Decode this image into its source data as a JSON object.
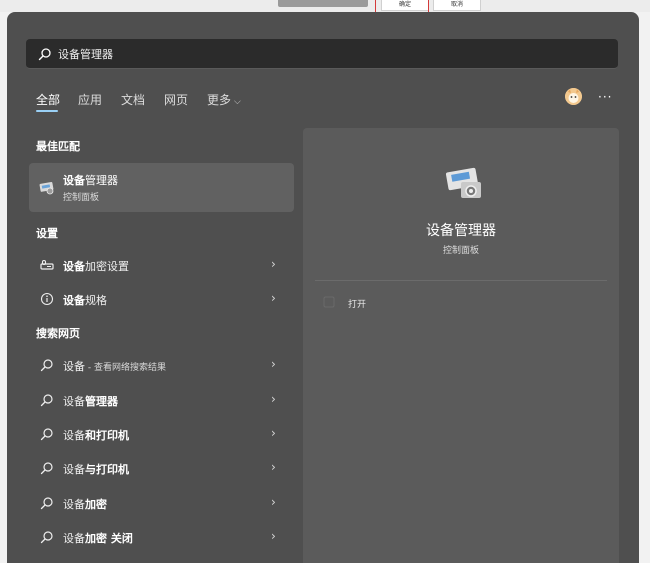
{
  "background": {
    "confirm_label": "确定",
    "cancel_label": "取消"
  },
  "search": {
    "value": "设备管理器"
  },
  "tabs": [
    {
      "label": "全部"
    },
    {
      "label": "应用"
    },
    {
      "label": "文档"
    },
    {
      "label": "网页"
    },
    {
      "label": "更多"
    }
  ],
  "sections": {
    "best_match": "最佳匹配",
    "settings": "设置",
    "web": "搜索网页"
  },
  "best_match": {
    "title_bold": "设备",
    "title_rest": "管理器",
    "subtitle": "控制面板"
  },
  "settings_items": [
    {
      "bold": "设备",
      "rest": "加密设置",
      "icon": "device-encryption-icon"
    },
    {
      "bold": "设备",
      "rest": "规格",
      "icon": "info-icon"
    }
  ],
  "web_items": [
    {
      "prefix": "设备",
      "bold": "",
      "suffix": " - 查看网络搜索结果"
    },
    {
      "prefix": "设备",
      "bold": "管理器",
      "suffix": ""
    },
    {
      "prefix": "设备",
      "bold": "和打印机",
      "suffix": ""
    },
    {
      "prefix": "设备",
      "bold": "与打印机",
      "suffix": ""
    },
    {
      "prefix": "设备",
      "bold": "加密",
      "suffix": ""
    },
    {
      "prefix": "设备",
      "bold": "加密 关闭",
      "suffix": ""
    }
  ],
  "detail": {
    "title": "设备管理器",
    "subtitle": "控制面板",
    "open_label": "打开"
  },
  "more_options_label": "···",
  "colors": {
    "panel": "#4f4f4f",
    "accent": "#9ad0f5",
    "selected": "#616161"
  }
}
